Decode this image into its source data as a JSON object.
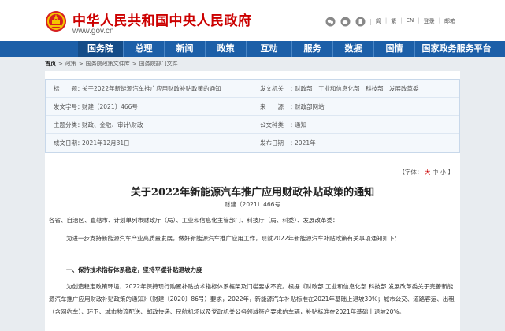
{
  "header": {
    "site_title": "中华人民共和国中央人民政府",
    "site_url": "www.gov.cn",
    "links": [
      "简",
      "繁",
      "EN",
      "登录",
      "邮箱"
    ]
  },
  "nav": {
    "items": [
      "国务院",
      "总理",
      "新闻",
      "政策",
      "互动",
      "服务",
      "数据",
      "国情",
      "国家政务服务平台"
    ]
  },
  "breadcrumb": {
    "home": "首页",
    "items": [
      "政策",
      "国务院政策文件库",
      "国务院部门文件"
    ]
  },
  "meta": {
    "index_label": "标　　题：",
    "rows": [
      {
        "l1": "标　　题",
        "v1": "关于2022年新能源汽车推广应用财政补贴政策的通知",
        "l2": "发文机关",
        "v2": "财政部　工业和信息化部　科技部　发展改革委"
      },
      {
        "l1": "发文字号",
        "v1": "财建〔2021〕466号",
        "l2": "来　　源",
        "v2": "财政部网站"
      },
      {
        "l1": "主题分类",
        "v1": "财政、金融、审计\\财政",
        "l2": "公文种类",
        "v2": "通知"
      },
      {
        "l1": "成文日期",
        "v1": "2021年12月31日",
        "l2": "发布日期",
        "v2": "2021年"
      }
    ]
  },
  "fontsize": {
    "label": "【字体：",
    "big": "大",
    "mid": "中",
    "small": "小",
    "end": "】"
  },
  "doc": {
    "title": "关于2022年新能源汽车推广应用财政补贴政策的通知",
    "number": "财建〔2021〕466号",
    "p1": "各省、自治区、直辖市、计划单列市财政厅（局）、工业和信息化主管部门、科技厅（局、科委）、发展改革委：",
    "p2": "为进一步支持新能源汽车产业高质量发展，做好新能源汽车推广应用工作，现就2022年新能源汽车补贴政策有关事项通知如下：",
    "p3": "一、保持技术指标体系稳定，坚持平缓补贴退坡力度",
    "p4": "为创造稳定政策环境，2022年保持现行购置补贴技术指标体系框架及门槛要求不变。根据《财政部 工业和信息化部 科技部 发展改革委关于完善新能源汽车推广应用财政补贴政策的通知》（财建〔2020〕86号）要求，2022年，新能源汽车补贴标准在2021年基础上退坡30%；城市公交、道路客运、出租（含网约车）、环卫、城市物流配送、邮政快递、民航机场以及党政机关公务领域符合要求的车辆，补贴标准在2021年基础上退坡20%。"
  },
  "colors": {
    "brand_red": "#cc0000",
    "nav_blue": "#1c5fa8",
    "nav_active": "#144c88"
  }
}
